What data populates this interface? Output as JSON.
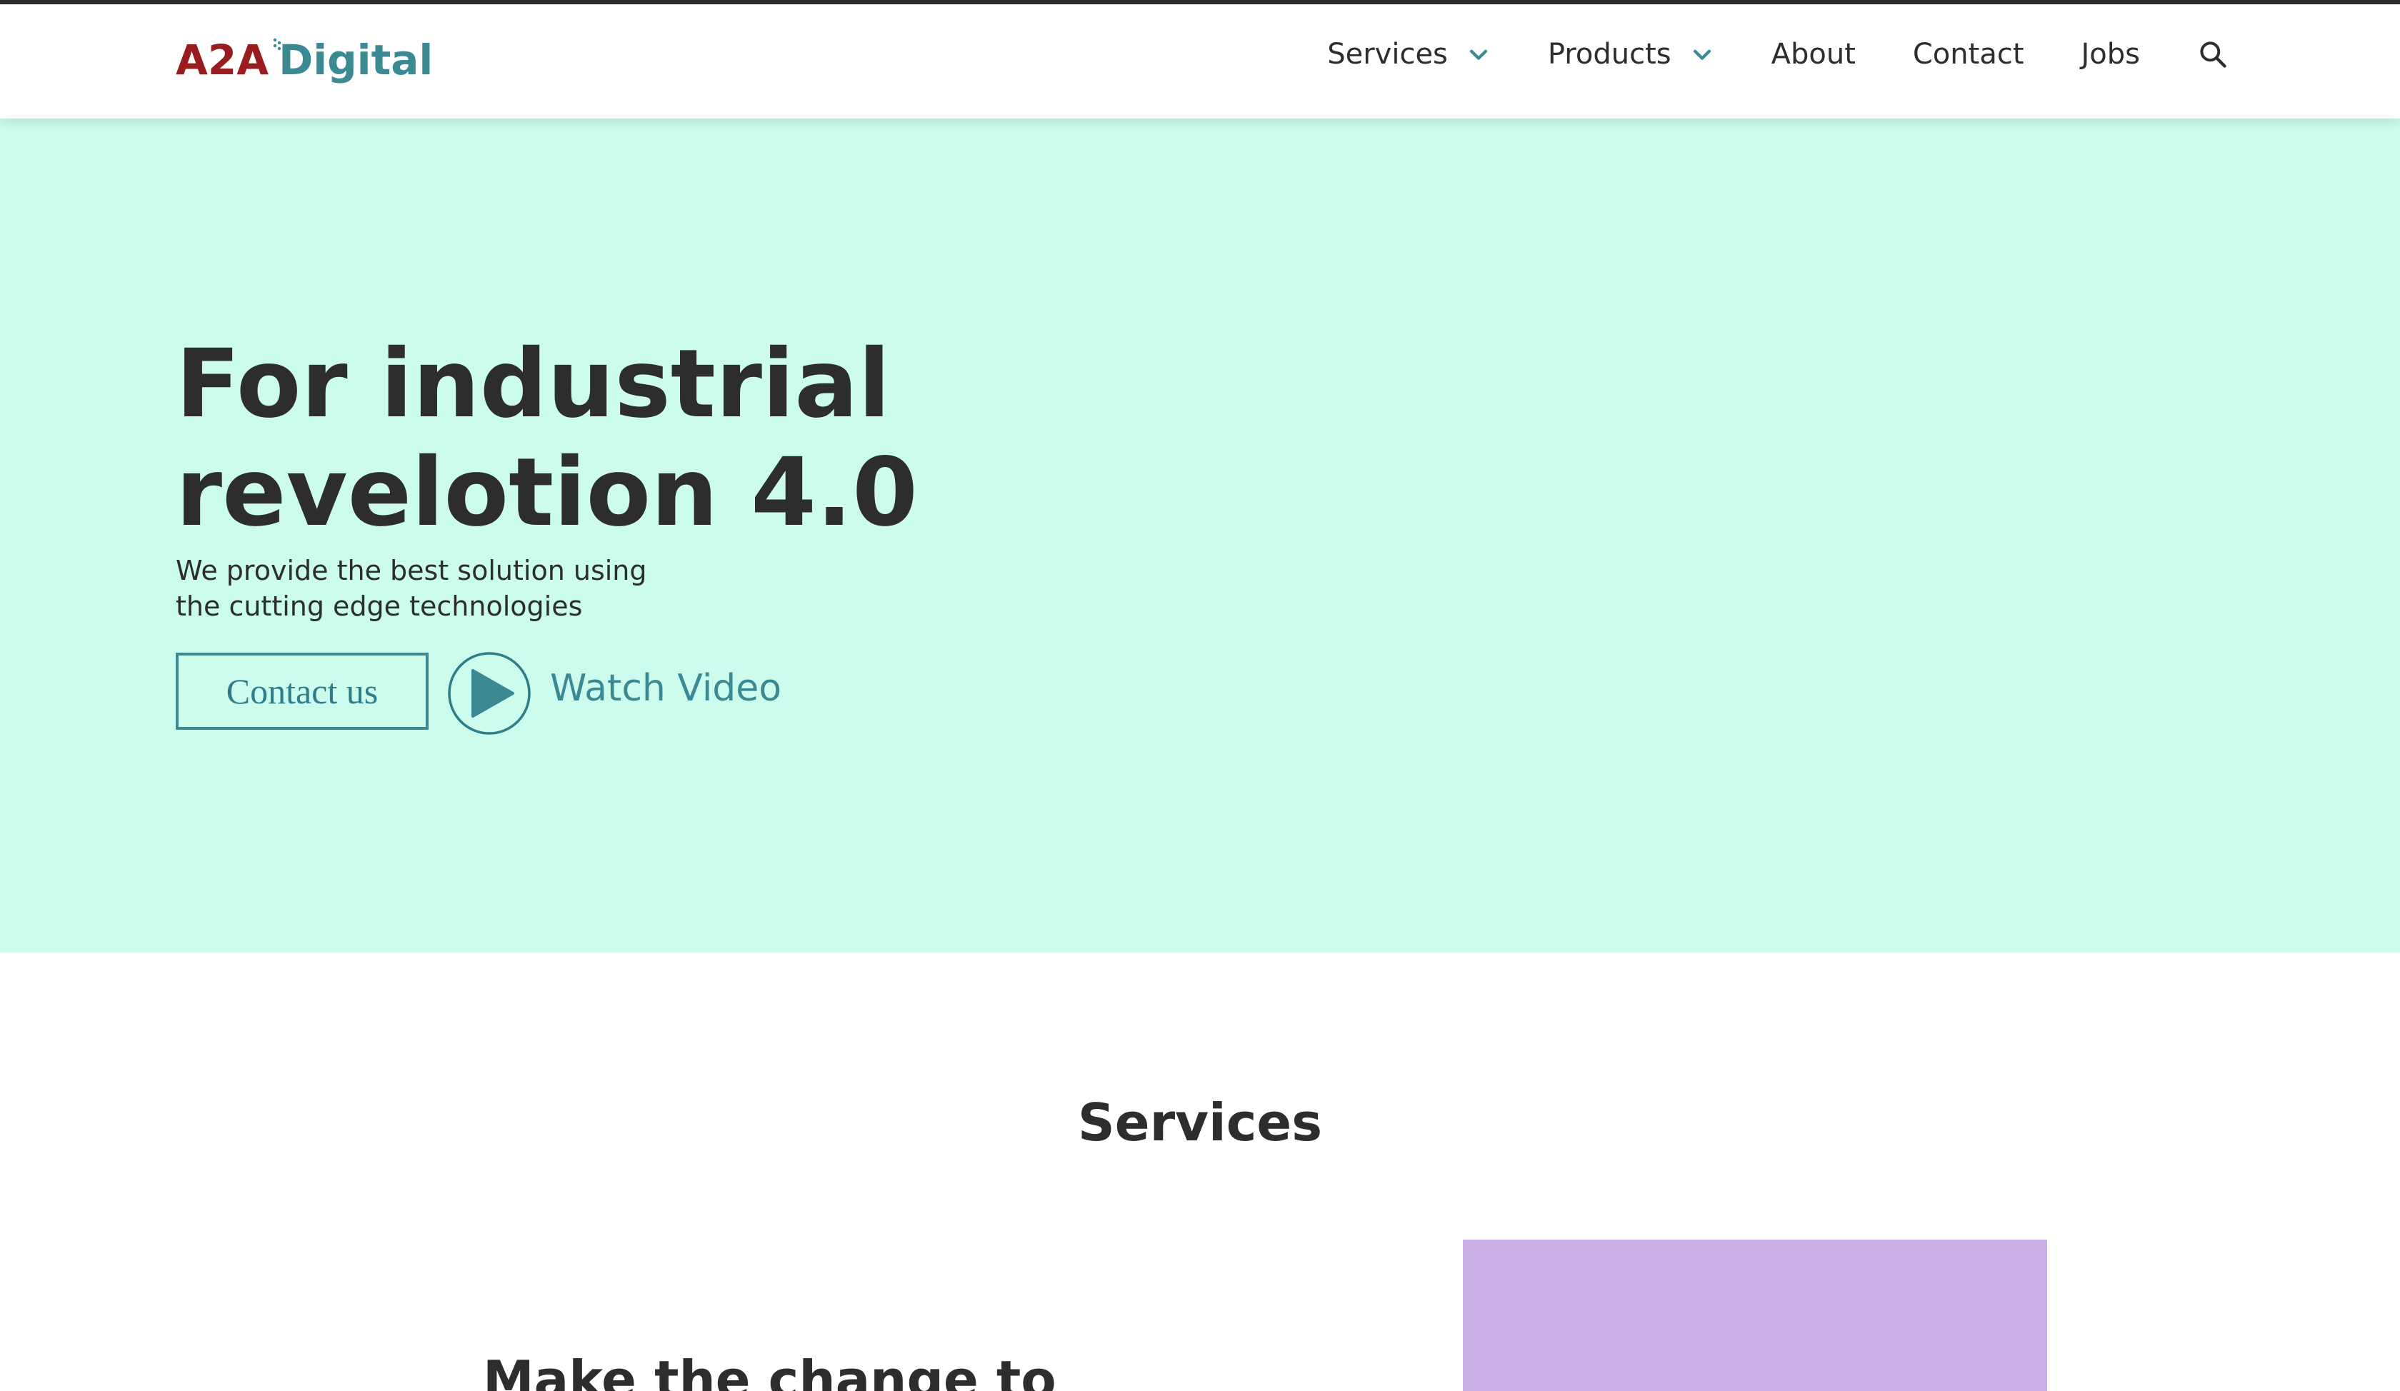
{
  "brand": {
    "logo_part1": "A2A",
    "logo_part2": "Digital",
    "color_primary": "#9b1c1f",
    "color_secondary": "#3b8a93"
  },
  "nav": {
    "items": [
      {
        "label": "Services",
        "has_dropdown": true
      },
      {
        "label": "Products",
        "has_dropdown": true
      },
      {
        "label": "About"
      },
      {
        "label": "Contact"
      },
      {
        "label": "Jobs"
      }
    ],
    "search_icon": "search-icon"
  },
  "hero": {
    "title_line1": "For industrial",
    "title_line2": "revelotion 4.0",
    "subtitle_line1": "We provide the best solution using",
    "subtitle_line2": "the cutting edge technologies",
    "contact_button": "Contact us",
    "watch_video": "Watch Video",
    "background": "#ccfcee"
  },
  "services": {
    "title": "Services",
    "card_heading": "Make the change to",
    "image_color": "#c8afe4"
  }
}
